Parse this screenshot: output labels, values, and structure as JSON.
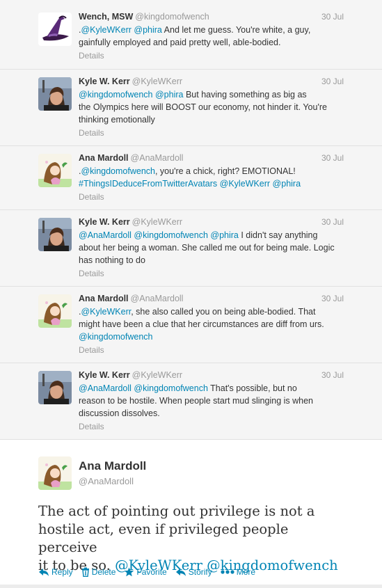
{
  "colors": {
    "link": "#0084b4",
    "meta": "#999999",
    "text": "#333333",
    "thread_bg": "#f5f5f5"
  },
  "replies": [
    {
      "avatar": "witch-hat-avatar",
      "name": "Wench, MSW",
      "handle": "@kingdomofwench",
      "time": "30 Jul",
      "lines": [
        [
          {
            "t": ".",
            "m": false
          },
          {
            "t": "@KyleWKerr",
            "m": true
          },
          {
            "t": " ",
            "m": false
          },
          {
            "t": "@phira",
            "m": true
          },
          {
            "t": " And let me guess. You're white, a guy,",
            "m": false
          }
        ],
        [
          {
            "t": "gainfully employed and paid pretty well, able-bodied.",
            "m": false
          }
        ]
      ],
      "details": "Details"
    },
    {
      "avatar": "kyle-photo-avatar",
      "name": "Kyle W. Kerr",
      "handle": "@KyleWKerr",
      "time": "30 Jul",
      "lines": [
        [
          {
            "t": "@kingdomofwench",
            "m": true
          },
          {
            "t": " ",
            "m": false
          },
          {
            "t": "@phira",
            "m": true
          },
          {
            "t": " But having something as big as",
            "m": false
          }
        ],
        [
          {
            "t": "the Olympics here will BOOST our economy, not hinder it. You're",
            "m": false
          }
        ],
        [
          {
            "t": "thinking emotionally",
            "m": false
          }
        ]
      ],
      "details": "Details"
    },
    {
      "avatar": "ana-drawing-avatar",
      "name": "Ana Mardoll",
      "handle": "@AnaMardoll",
      "time": "30 Jul",
      "lines": [
        [
          {
            "t": ".",
            "m": false
          },
          {
            "t": "@kingdomofwench",
            "m": true
          },
          {
            "t": ", you're a chick, right? EMOTIONAL!",
            "m": false
          }
        ],
        [
          {
            "t": "#ThingsIDeduceFromTwitterAvatars",
            "m": true
          },
          {
            "t": " ",
            "m": false
          },
          {
            "t": "@KyleWKerr",
            "m": true
          },
          {
            "t": " ",
            "m": false
          },
          {
            "t": "@phira",
            "m": true
          }
        ]
      ],
      "details": "Details"
    },
    {
      "avatar": "kyle-photo-avatar",
      "name": "Kyle W. Kerr",
      "handle": "@KyleWKerr",
      "time": "30 Jul",
      "lines": [
        [
          {
            "t": "@AnaMardoll",
            "m": true
          },
          {
            "t": " ",
            "m": false
          },
          {
            "t": "@kingdomofwench",
            "m": true
          },
          {
            "t": " ",
            "m": false
          },
          {
            "t": "@phira",
            "m": true
          },
          {
            "t": " I didn't say anything",
            "m": false
          }
        ],
        [
          {
            "t": "about her being a woman. She called me out for being male. Logic",
            "m": false
          }
        ],
        [
          {
            "t": "has nothing to do",
            "m": false
          }
        ]
      ],
      "details": "Details"
    },
    {
      "avatar": "ana-drawing-avatar",
      "name": "Ana Mardoll",
      "handle": "@AnaMardoll",
      "time": "30 Jul",
      "lines": [
        [
          {
            "t": ".",
            "m": false
          },
          {
            "t": "@KyleWKerr",
            "m": true
          },
          {
            "t": ", she also called you on being able-bodied. That",
            "m": false
          }
        ],
        [
          {
            "t": "might have been a clue that her circumstances are diff from urs.",
            "m": false
          }
        ],
        [
          {
            "t": "@kingdomofwench",
            "m": true
          }
        ]
      ],
      "details": "Details"
    },
    {
      "avatar": "kyle-photo-avatar",
      "name": "Kyle W. Kerr",
      "handle": "@KyleWKerr",
      "time": "30 Jul",
      "lines": [
        [
          {
            "t": "@AnaMardoll",
            "m": true
          },
          {
            "t": " ",
            "m": false
          },
          {
            "t": "@kingdomofwench",
            "m": true
          },
          {
            "t": " That's possible, but no",
            "m": false
          }
        ],
        [
          {
            "t": "reason to be hostile. When people start mud slinging is when",
            "m": false
          }
        ],
        [
          {
            "t": "discussion dissolves.",
            "m": false
          }
        ]
      ],
      "details": "Details"
    }
  ],
  "main_tweet": {
    "name": "Ana Mardoll",
    "handle": "@AnaMardoll",
    "lines": [
      [
        {
          "t": "The act of pointing out privilege is not a",
          "m": false
        }
      ],
      [
        {
          "t": "hostile act, even if privileged people perceive",
          "m": false
        }
      ],
      [
        {
          "t": "it to be so. ",
          "m": false
        },
        {
          "t": "@KyleWKerr",
          "m": true
        },
        {
          "t": " ",
          "m": false
        },
        {
          "t": "@kingdomofwench",
          "m": true
        }
      ]
    ],
    "actions": [
      {
        "label": "Reply",
        "icon": "reply-icon"
      },
      {
        "label": "Delete",
        "icon": "trash-icon"
      },
      {
        "label": "Favorite",
        "icon": "star-icon"
      },
      {
        "label": "Storify",
        "icon": "storify-icon"
      },
      {
        "label": "More",
        "icon": "more-dots-icon"
      }
    ]
  }
}
